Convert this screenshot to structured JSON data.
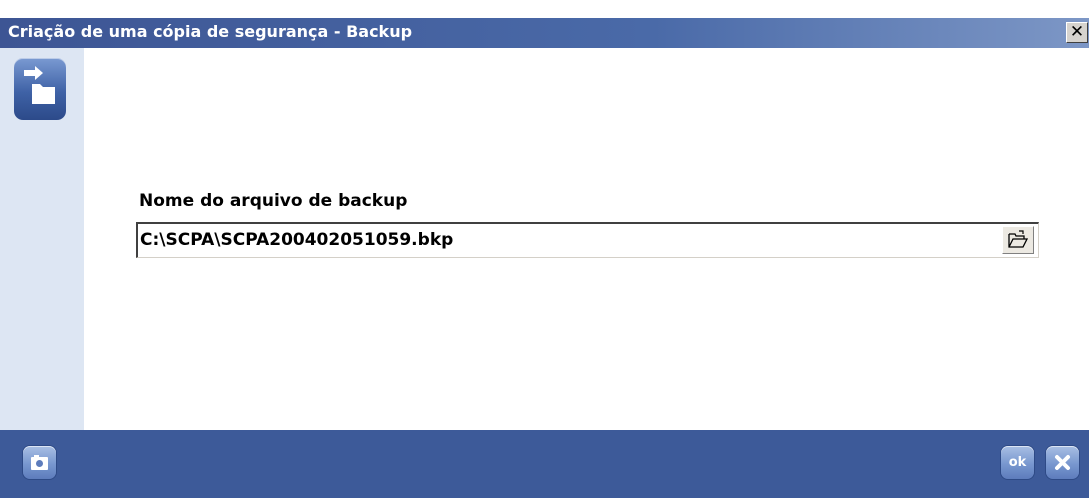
{
  "window": {
    "title": "Criação de uma cópia de segurança - Backup",
    "close_glyph": "✕"
  },
  "form": {
    "field_label": "Nome do arquivo de backup",
    "file_value": "C:\\SCPA\\SCPA200402051059.bkp"
  },
  "footer": {
    "ok_label": "ok"
  },
  "icons": {
    "app": "folder-arrow-icon",
    "browse": "open-folder-icon",
    "left_footer": "camera-icon",
    "ok": "ok-icon",
    "cancel": "close-icon"
  },
  "colors": {
    "titlebar": "#3d5594",
    "footer": "#3d5a99",
    "sidebar": "#dde6f3",
    "button": "#7897cf"
  }
}
